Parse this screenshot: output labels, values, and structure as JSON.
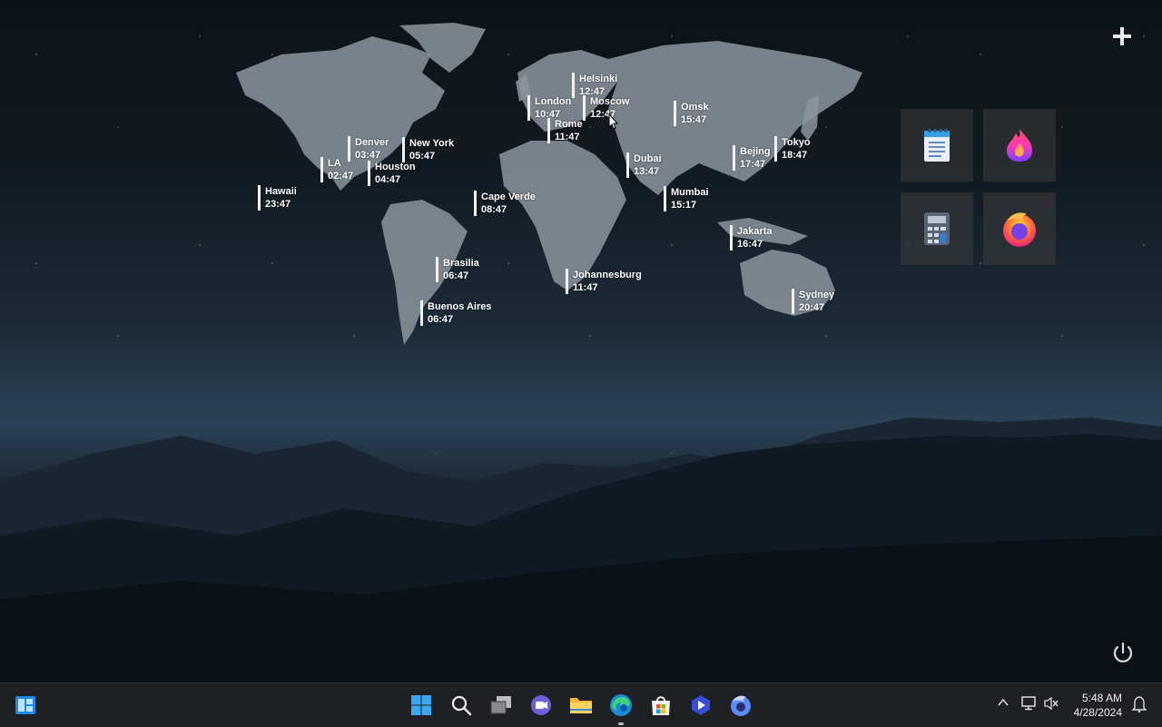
{
  "cities": [
    {
      "name": "Helsinki",
      "time": "12:47"
    },
    {
      "name": "London",
      "time": "10:47"
    },
    {
      "name": "Moscow",
      "time": "12:47"
    },
    {
      "name": "Omsk",
      "time": "15:47"
    },
    {
      "name": "Rome",
      "time": "11:47"
    },
    {
      "name": "Denver",
      "time": "03:47"
    },
    {
      "name": "New York",
      "time": "05:47"
    },
    {
      "name": "LA",
      "time": "02:47"
    },
    {
      "name": "Houston",
      "time": "04:47"
    },
    {
      "name": "Hawaii",
      "time": "23:47"
    },
    {
      "name": "Bejing",
      "time": "17:47"
    },
    {
      "name": "Tokyo",
      "time": "18:47"
    },
    {
      "name": "Dubai",
      "time": "13:47"
    },
    {
      "name": "Mumbai",
      "time": "15:17"
    },
    {
      "name": "Cape Verde",
      "time": "08:47"
    },
    {
      "name": "Jakarta",
      "time": "16:47"
    },
    {
      "name": "Brasilia",
      "time": "06:47"
    },
    {
      "name": "Johannesburg",
      "time": "11:47"
    },
    {
      "name": "Sydney",
      "time": "20:47"
    },
    {
      "name": "Buenos Aires",
      "time": "06:47"
    }
  ],
  "tiles": [
    {
      "icon": "notepad-icon"
    },
    {
      "icon": "firefox-nightly-icon"
    },
    {
      "icon": "calculator-icon"
    },
    {
      "icon": "firefox-icon"
    }
  ],
  "taskbar": {
    "left_icon": "widgets-icon",
    "center_icons": [
      "start-icon",
      "search-icon",
      "task-view-icon",
      "teams-chat-icon",
      "file-explorer-icon",
      "edge-icon",
      "microsoft-store-icon",
      "clipchamp-icon",
      "firefox-icon"
    ],
    "tray_icons": [
      "chevron-up-icon",
      "network-icon",
      "volume-muted-icon",
      "notification-icon"
    ]
  },
  "clock": {
    "time": "5:48 AM",
    "date": "4/28/2024"
  },
  "colors": {
    "taskbar": "#1f2023",
    "map_land": "#8c959d",
    "label_bar": "#f2f2f2"
  }
}
